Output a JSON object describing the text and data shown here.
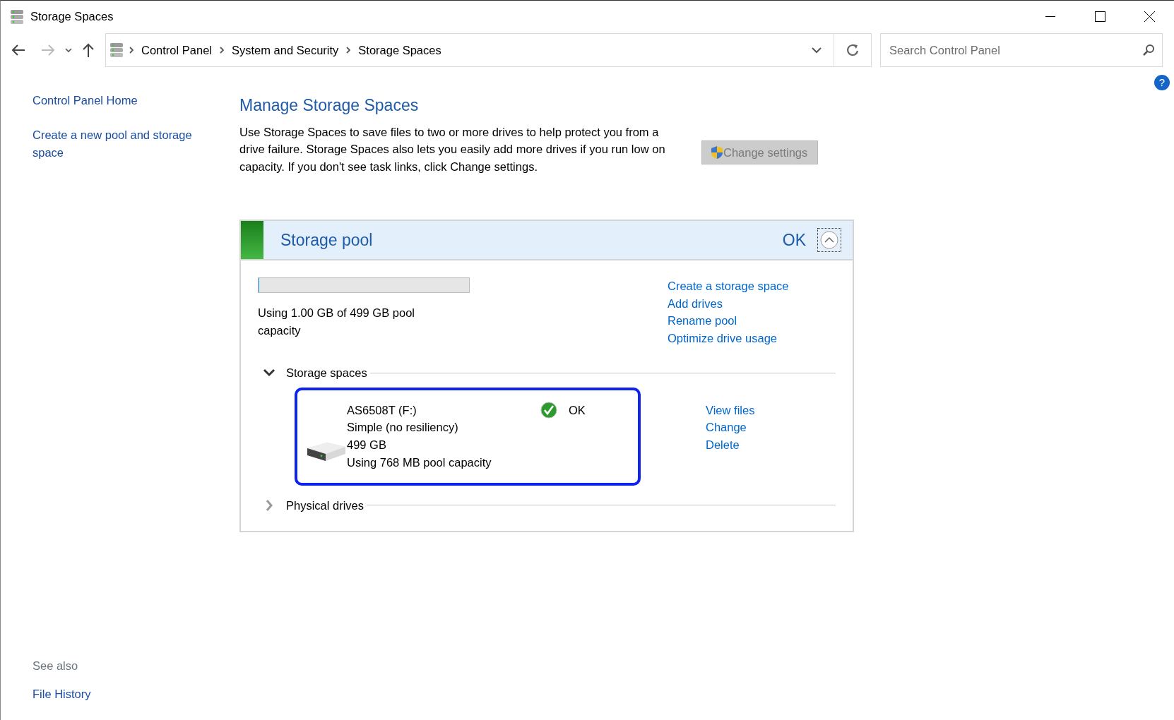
{
  "window": {
    "title": "Storage Spaces"
  },
  "address_bar": {
    "breadcrumbs": [
      "Control Panel",
      "System and Security",
      "Storage Spaces"
    ]
  },
  "search": {
    "placeholder": "Search Control Panel"
  },
  "help_button": "?",
  "sidebar": {
    "items": [
      "Control Panel Home",
      "Create a new pool and storage space"
    ],
    "see_also_label": "See also",
    "see_also": [
      "File History"
    ]
  },
  "main": {
    "heading": "Manage Storage Spaces",
    "description": "Use Storage Spaces to save files to two or more drives to help protect you from a drive failure. Storage Spaces also lets you easily add more drives if you run low on capacity. If you don't see task links, click Change settings.",
    "change_settings_button": {
      "label": "Change settings",
      "disabled": true
    }
  },
  "pool": {
    "title": "Storage pool",
    "status": "OK",
    "expanded": true,
    "level": 0.002,
    "usage": "Using 1.00 GB of 499 GB pool capacity",
    "links": [
      "Create a storage space",
      "Add drives",
      "Rename pool",
      "Optimize drive usage"
    ],
    "sections": [
      {
        "title": "Storage spaces",
        "expanded": true,
        "spaces": [
          {
            "name": "AS6508T (F:)",
            "resiliency": "Simple (no resiliency)",
            "size": "499 GB",
            "usage": "Using 768 MB pool capacity",
            "status": "OK",
            "selected": true,
            "links": [
              "View files",
              "Change",
              "Delete"
            ]
          }
        ]
      },
      {
        "title": "Physical drives",
        "expanded": false
      }
    ]
  }
}
